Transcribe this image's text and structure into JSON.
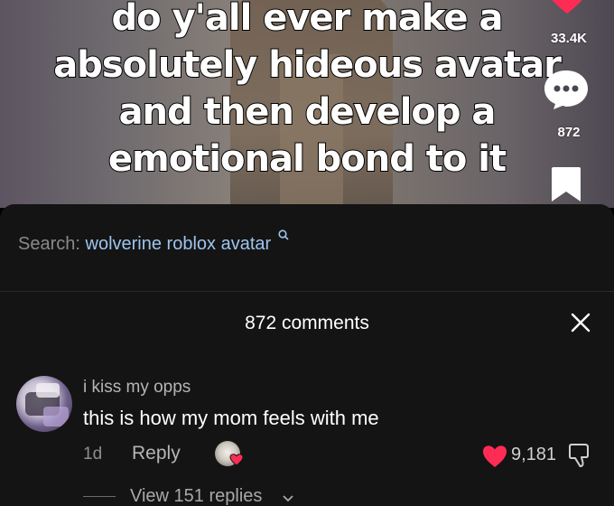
{
  "video": {
    "caption_lines": [
      "do y'all ever make a",
      "absolutely hideous avatar",
      "and then develop a",
      "emotional bond to it"
    ]
  },
  "rail": {
    "like_count": "33.4K",
    "comment_count": "872",
    "icons": [
      "heart-icon",
      "comment-icon",
      "bookmark-icon"
    ]
  },
  "search": {
    "prefix": "Search:",
    "term": "wolverine roblox avatar"
  },
  "comments": {
    "title": "872 comments",
    "items": [
      {
        "username": "i kiss my opps",
        "text": "this is how my mom feels with me",
        "time": "1d",
        "reply_label": "Reply",
        "like_count": "9,181",
        "liked": true,
        "creator_liked": true,
        "view_replies": "View 151 replies"
      }
    ]
  },
  "colors": {
    "sheet_bg": "#141414",
    "like_red": "#fe2c55",
    "search_link": "#9ec4ee"
  }
}
